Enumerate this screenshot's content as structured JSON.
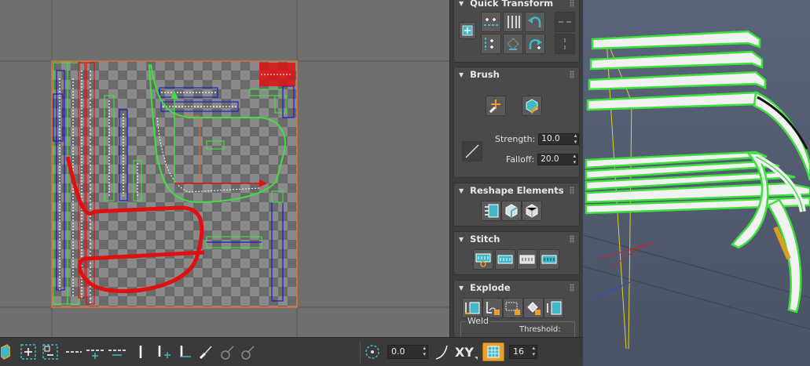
{
  "panel": {
    "quick_transform": {
      "title": "Quick Transform"
    },
    "brush": {
      "title": "Brush",
      "strength_label": "Strength:",
      "strength_value": "10.0",
      "falloff_label": "Falloff:",
      "falloff_value": "20.0"
    },
    "reshape_elements": {
      "title": "Reshape Elements"
    },
    "stitch": {
      "title": "Stitch"
    },
    "explode": {
      "title": "Explode",
      "weld_label": "Weld",
      "threshold_label": "Threshold:"
    }
  },
  "bottom_bar": {
    "angle_value": "0.0",
    "axis_label": "XY",
    "grid_value": "16"
  },
  "colors": {
    "accent_teal": "#41b8c8",
    "selection_green": "#3ee03e",
    "uv_red": "#e01010",
    "uv_blue": "#1a1ad0",
    "bounds_orange": "#e07030"
  }
}
